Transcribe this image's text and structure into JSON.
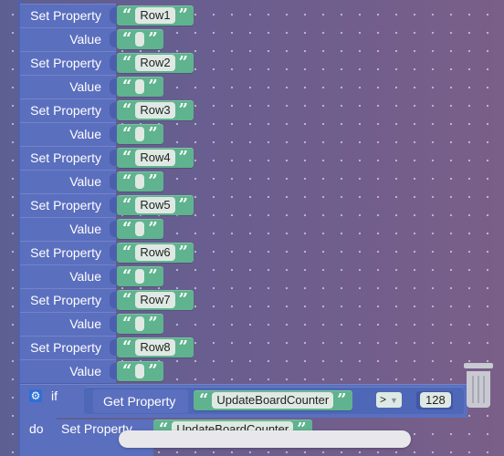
{
  "blocks": [
    {
      "set_label": "Set Property",
      "value_label": "Value",
      "property": "Row1",
      "value": ""
    },
    {
      "set_label": "Set Property",
      "value_label": "Value",
      "property": "Row2",
      "value": ""
    },
    {
      "set_label": "Set Property",
      "value_label": "Value",
      "property": "Row3",
      "value": ""
    },
    {
      "set_label": "Set Property",
      "value_label": "Value",
      "property": "Row4",
      "value": ""
    },
    {
      "set_label": "Set Property",
      "value_label": "Value",
      "property": "Row5",
      "value": ""
    },
    {
      "set_label": "Set Property",
      "value_label": "Value",
      "property": "Row6",
      "value": ""
    },
    {
      "set_label": "Set Property",
      "value_label": "Value",
      "property": "Row7",
      "value": ""
    },
    {
      "set_label": "Set Property",
      "value_label": "Value",
      "property": "Row8",
      "value": ""
    }
  ],
  "if_block": {
    "if_label": "if",
    "do_label": "do",
    "gear_icon": "gear-icon",
    "get_label": "Get Property",
    "get_property": "UpdateBoardCounter",
    "operator": ">",
    "operand": "128"
  },
  "inner_set": {
    "set_label": "Set Property",
    "property": "UpdateBoardCounter"
  },
  "quotes": {
    "open": "“",
    "close": "”"
  },
  "colors": {
    "block_blue": "#5b6fbf",
    "string_green": "#5fb38e",
    "field_bg": "#dfe9e3"
  }
}
